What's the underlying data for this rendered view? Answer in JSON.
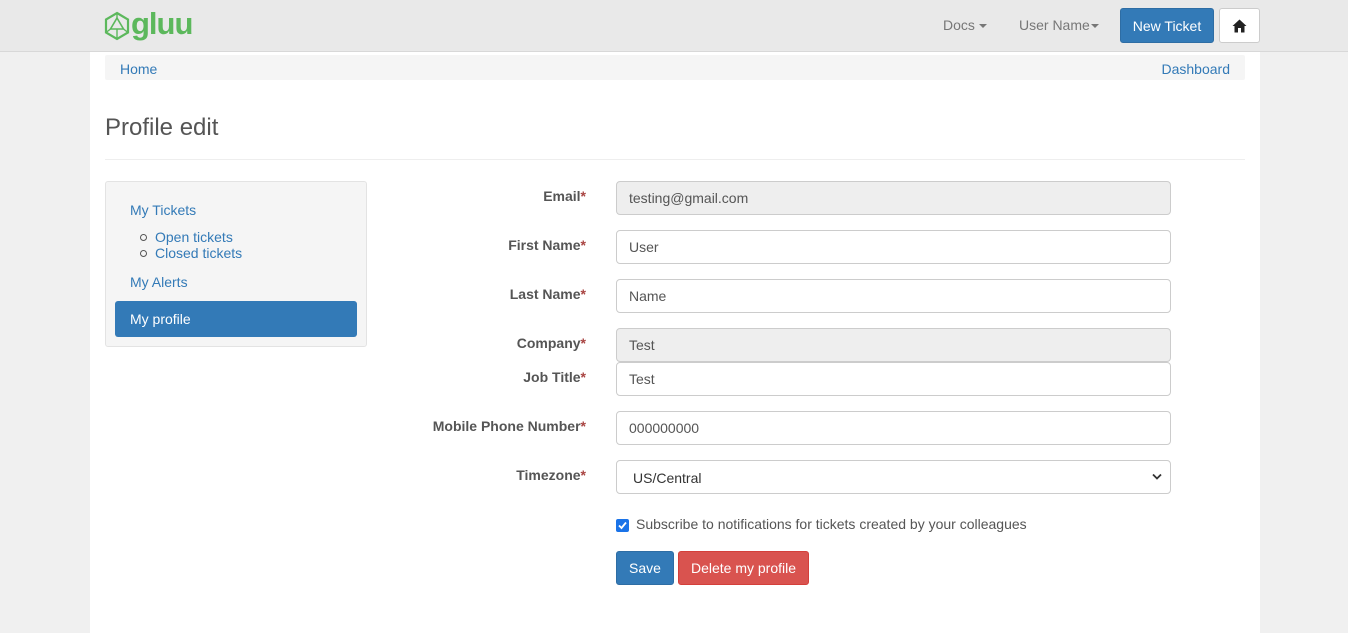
{
  "nav": {
    "logo_text": "gluu",
    "docs_label": "Docs",
    "user_label": "User Name",
    "new_ticket_label": "New Ticket",
    "home_icon": "home-icon"
  },
  "breadcrumb": {
    "home": "Home",
    "dashboard": "Dashboard"
  },
  "page": {
    "title": "Profile edit"
  },
  "sidebar": {
    "my_tickets": "My Tickets",
    "sub_items": [
      "Open tickets",
      "Closed tickets"
    ],
    "my_alerts": "My Alerts",
    "my_profile": "My profile"
  },
  "form": {
    "required_marker": "*",
    "fields": [
      {
        "label": "Email",
        "value": "testing@gmail.com",
        "readonly": true
      },
      {
        "label": "First Name",
        "value": "User",
        "readonly": false
      },
      {
        "label": "Last Name",
        "value": "Name",
        "readonly": false
      },
      {
        "label": "Company",
        "value": "Test",
        "readonly": true
      },
      {
        "label": "Job Title",
        "value": "Test",
        "readonly": false
      },
      {
        "label": "Mobile Phone Number",
        "value": "000000000",
        "readonly": false
      }
    ],
    "timezone": {
      "label": "Timezone",
      "value": "US/Central"
    },
    "subscribe": {
      "label": "Subscribe to notifications for tickets created by your colleagues",
      "checked": true
    },
    "save_label": "Save",
    "delete_label": "Delete my profile"
  },
  "colors": {
    "primary": "#337ab7",
    "danger": "#d9534f",
    "logo_green": "#5cb85c"
  }
}
